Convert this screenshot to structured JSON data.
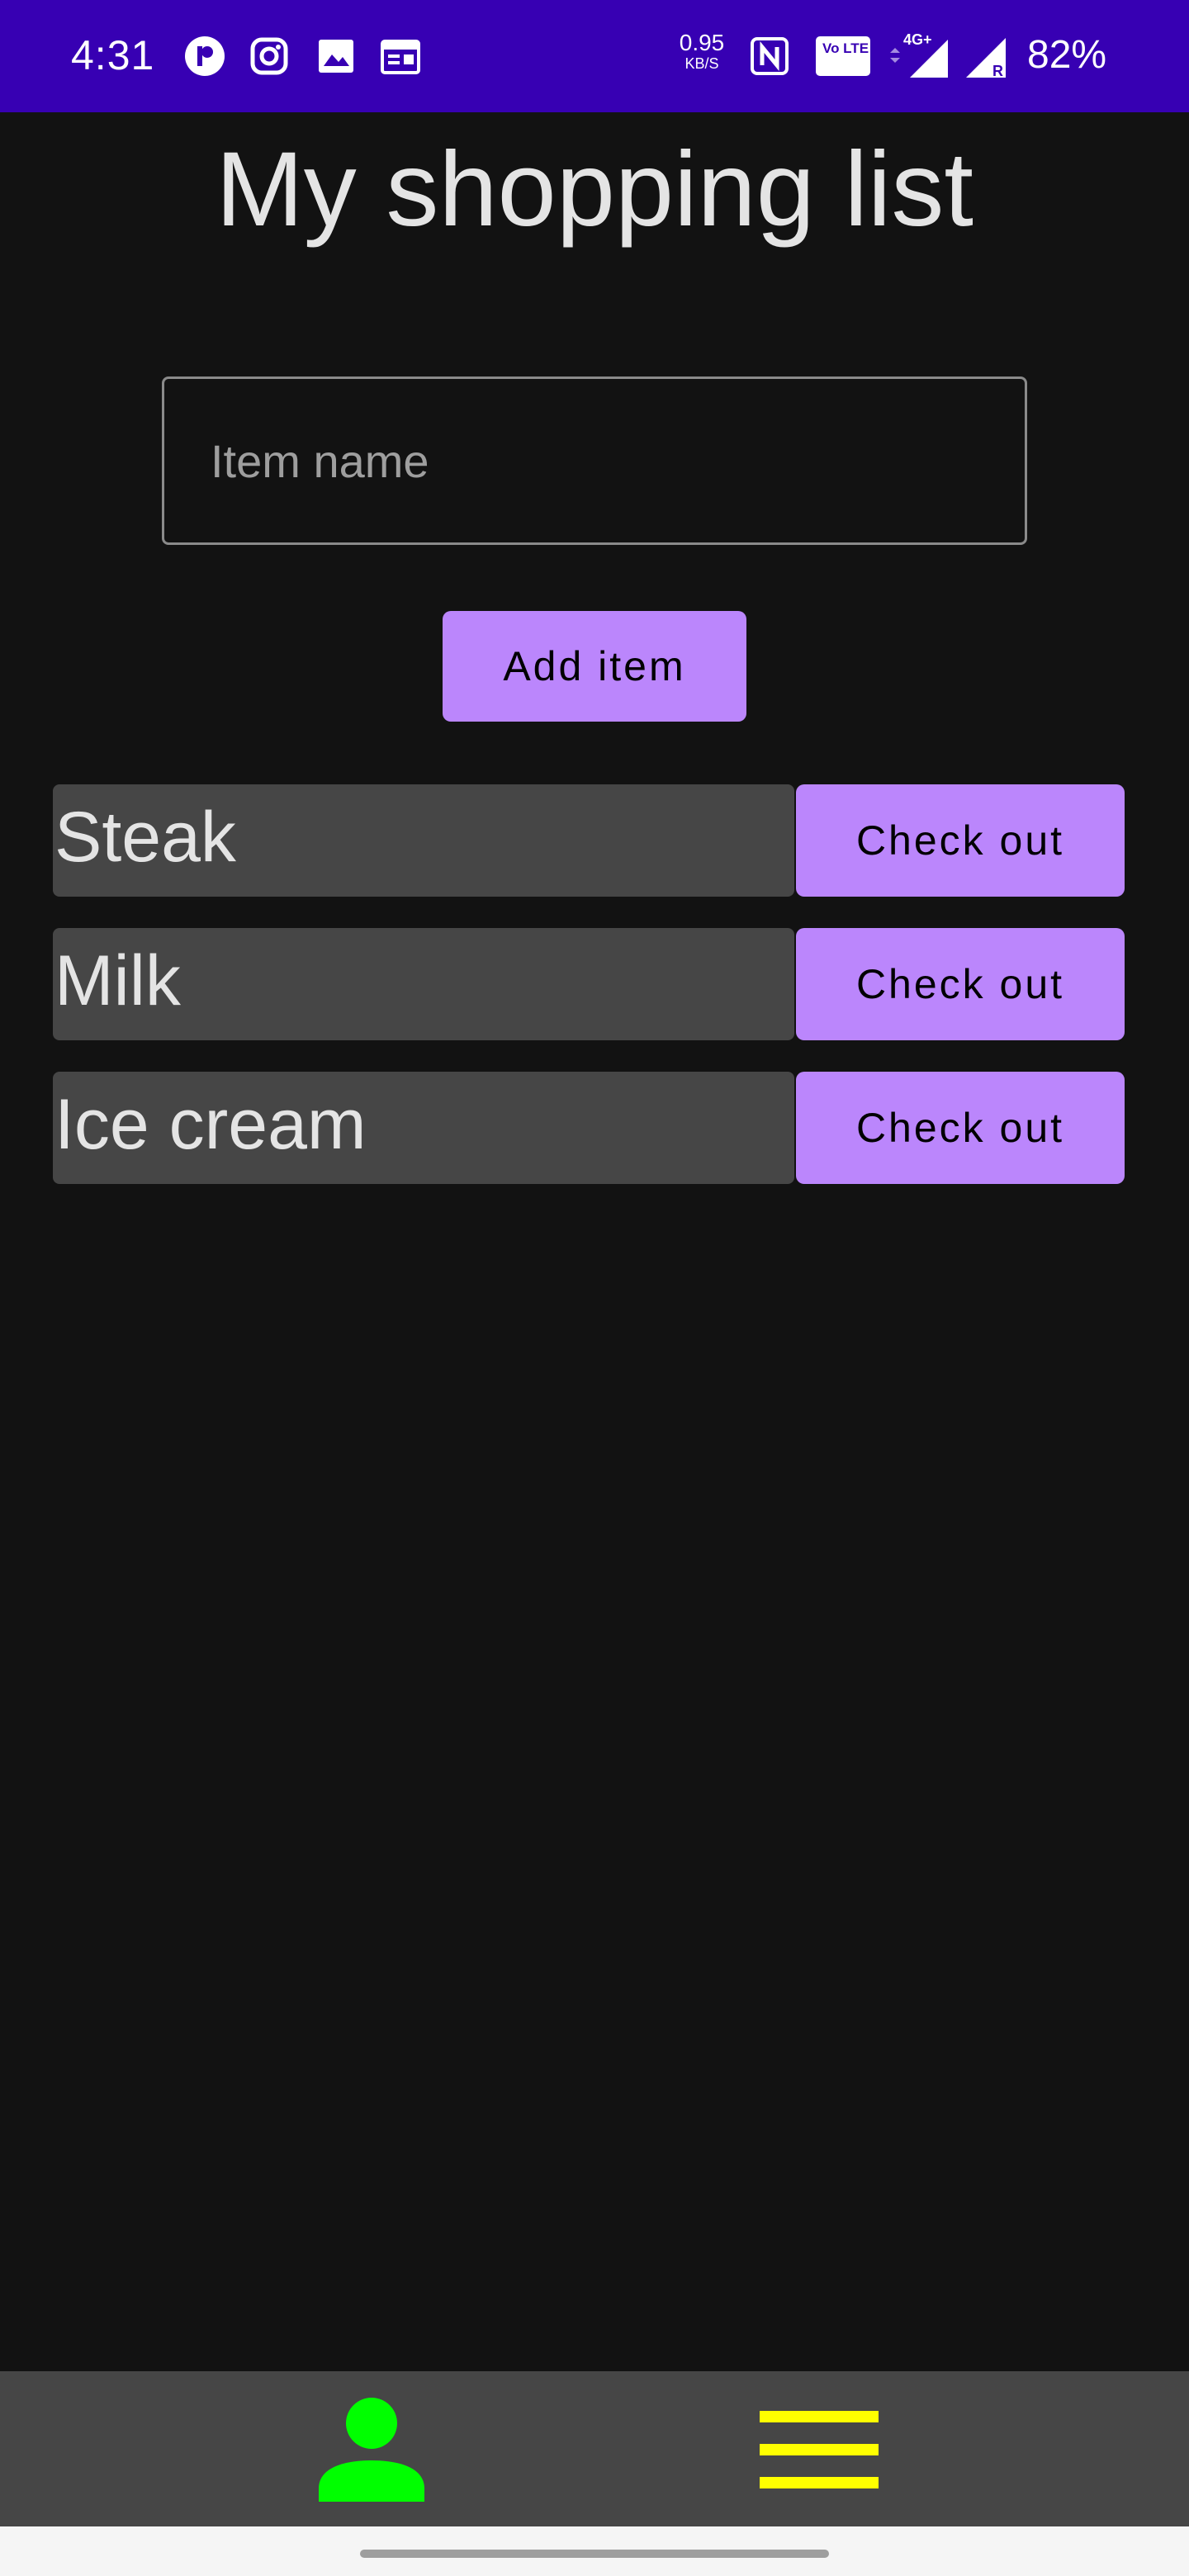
{
  "status_bar": {
    "time": "4:31",
    "net_speed_value": "0.95",
    "net_speed_unit": "KB/S",
    "volte_label": "Vo LTE 1",
    "network_type": "4G+",
    "roaming_label": "R",
    "battery": "82%",
    "icons": [
      "app-notification-icon",
      "instagram-icon",
      "gallery-icon",
      "calendar-icon",
      "nfc-icon",
      "volte-icon",
      "signal-4g-icon",
      "signal-roaming-icon"
    ],
    "background_color": "#3700b3"
  },
  "header": {
    "title": "My shopping list"
  },
  "form": {
    "input_placeholder": "Item name",
    "input_value": "",
    "add_button_label": "Add item"
  },
  "items": [
    {
      "name": "Steak",
      "action_label": "Check out"
    },
    {
      "name": "Milk",
      "action_label": "Check out"
    },
    {
      "name": "Ice cream",
      "action_label": "Check out"
    }
  ],
  "bottom_nav": {
    "icons": [
      "person-icon",
      "menu-icon"
    ],
    "person_color": "#00ff00",
    "menu_color": "#ffff00"
  },
  "theme": {
    "accent": "#bb86fc",
    "background": "#121212",
    "surface": "#464646"
  }
}
